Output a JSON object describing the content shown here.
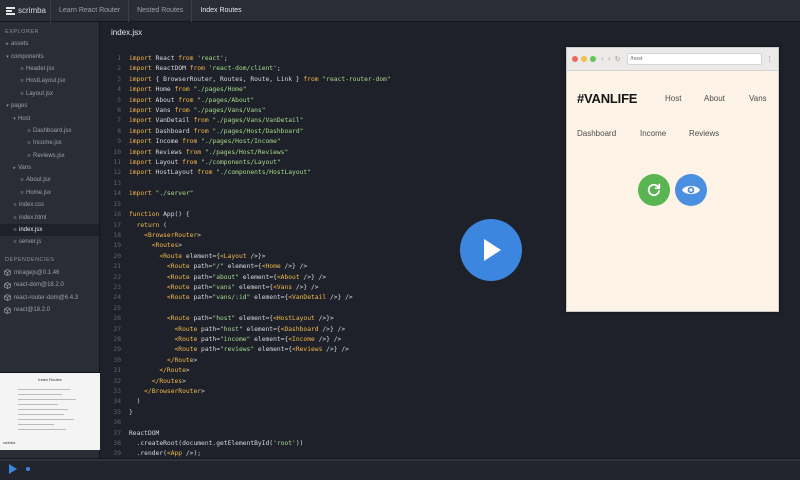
{
  "topbar": {
    "logo": "scrimba",
    "breadcrumbs": [
      "Learn React Router",
      "Nested Routes",
      "Index Routes"
    ]
  },
  "sidebar": {
    "explorer_heading": "EXPLORER",
    "files": [
      {
        "label": "assets",
        "depth": 0,
        "type": "folder",
        "expanded": false
      },
      {
        "label": "components",
        "depth": 0,
        "type": "folder",
        "expanded": true
      },
      {
        "label": "Header.jsx",
        "depth": 1,
        "type": "file"
      },
      {
        "label": "HostLayout.jsx",
        "depth": 1,
        "type": "file"
      },
      {
        "label": "Layout.jsx",
        "depth": 1,
        "type": "file"
      },
      {
        "label": "pages",
        "depth": 0,
        "type": "folder",
        "expanded": true
      },
      {
        "label": "Host",
        "depth": 1,
        "type": "folder",
        "expanded": true
      },
      {
        "label": "Dashboard.jsx",
        "depth": 2,
        "type": "file"
      },
      {
        "label": "Income.jsx",
        "depth": 2,
        "type": "file"
      },
      {
        "label": "Reviews.jsx",
        "depth": 2,
        "type": "file"
      },
      {
        "label": "Vans",
        "depth": 1,
        "type": "folder",
        "expanded": false
      },
      {
        "label": "About.jsx",
        "depth": 1,
        "type": "file"
      },
      {
        "label": "Home.jsx",
        "depth": 1,
        "type": "file"
      },
      {
        "label": "index.css",
        "depth": 0,
        "type": "file"
      },
      {
        "label": "index.html",
        "depth": 0,
        "type": "file"
      },
      {
        "label": "index.jsx",
        "depth": 0,
        "type": "file",
        "selected": true
      },
      {
        "label": "server.js",
        "depth": 0,
        "type": "file"
      }
    ],
    "dependencies_heading": "DEPENDENCIES",
    "dependencies": [
      "miragejs@0.1.46",
      "react-dom@18.2.0",
      "react-router-dom@6.4.3",
      "react@18.2.0"
    ],
    "thumbnail_title": "Index Routes",
    "thumbnail_brand": "scrimba"
  },
  "editor": {
    "filename": "index.jsx",
    "lines": [
      "import React from 'react';",
      "import ReactDOM from 'react-dom/client';",
      "import { BrowserRouter, Routes, Route, Link } from \"react-router-dom\"",
      "import Home from \"./pages/Home\"",
      "import About from \"./pages/About\"",
      "import Vans from \"./pages/Vans/Vans\"",
      "import VanDetail from \"./pages/Vans/VanDetail\"",
      "import Dashboard from \"./pages/Host/Dashboard\"",
      "import Income from \"./pages/Host/Income\"",
      "import Reviews from \"./pages/Host/Reviews\"",
      "import Layout from \"./components/Layout\"",
      "import HostLayout from \"./components/HostLayout\"",
      "",
      "import \"./server\"",
      "",
      "function App() {",
      "  return (",
      "    <BrowserRouter>",
      "      <Routes>",
      "        <Route element={<Layout />}>",
      "          <Route path=\"/\" element={<Home />} />",
      "          <Route path=\"about\" element={<About />} />",
      "          <Route path=\"vans\" element={<Vans />} />",
      "          <Route path=\"vans/:id\" element={<VanDetail />} />",
      "",
      "          <Route path=\"host\" element={<HostLayout />}>",
      "            <Route path=\"host\" element={<Dashboard />} />",
      "            <Route path=\"income\" element={<Income />} />",
      "            <Route path=\"reviews\" element={<Reviews />} />",
      "          </Route>",
      "        </Route>",
      "      </Routes>",
      "    </BrowserRouter>",
      "  )",
      "}",
      "",
      "ReactDOM",
      "  .createRoot(document.getElementById('root'))",
      "  .render(<App />);"
    ]
  },
  "preview": {
    "url": "/host",
    "site_logo": "#VANLIFE",
    "nav_links": [
      "Host",
      "About",
      "Vans"
    ],
    "host_links": [
      "Dashboard",
      "Income",
      "Reviews"
    ],
    "colors": {
      "background": "#fdf3e6",
      "refresh_button": "#59b452",
      "eye_button": "#4b8fe2"
    }
  },
  "colors": {
    "accent": "#3d86e0",
    "editor_bg": "#1e2129",
    "sidebar_bg": "#2a2d36"
  }
}
